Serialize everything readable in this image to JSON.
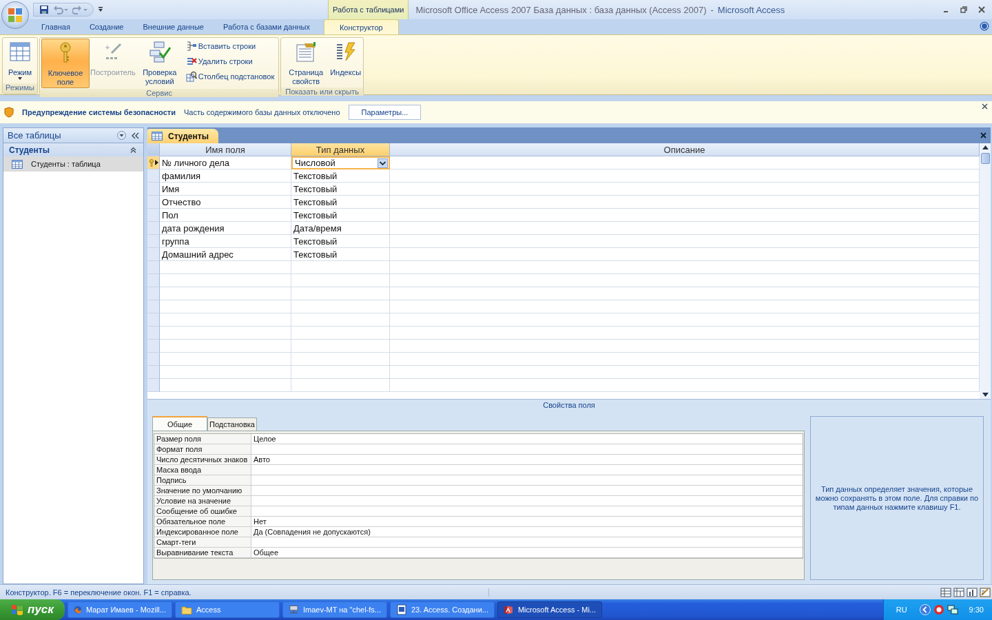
{
  "window": {
    "context": "Работа с таблицами",
    "title": "Microsoft Office Access 2007 База данных : база данных (Access 2007)",
    "separator": "-",
    "app": "Microsoft Access"
  },
  "ribbon_tabs": [
    {
      "label": "Главная",
      "selected": false
    },
    {
      "label": "Создание",
      "selected": false
    },
    {
      "label": "Внешние данные",
      "selected": false
    },
    {
      "label": "Работа с базами данных",
      "selected": false
    },
    {
      "label": "Конструктор",
      "selected": true
    }
  ],
  "ribbon_groups": [
    {
      "label": "Режимы",
      "buttons": [
        {
          "label": "Режим",
          "kind": "view",
          "selected": false,
          "disabled": false
        }
      ]
    },
    {
      "label": "Сервис",
      "buttons": [
        {
          "label": "Ключевое поле",
          "kind": "key",
          "selected": true,
          "disabled": false
        },
        {
          "label": "Построитель",
          "kind": "builder",
          "selected": false,
          "disabled": true
        },
        {
          "label": "Проверка условий",
          "kind": "check",
          "selected": false,
          "disabled": false
        },
        {
          "label": "Вставить строки",
          "kind": "insert",
          "selected": false,
          "disabled": false
        },
        {
          "label": "Удалить строки",
          "kind": "delete",
          "selected": false,
          "disabled": false
        },
        {
          "label": "Столбец  подстановок",
          "kind": "lookup",
          "selected": false,
          "disabled": false
        }
      ]
    },
    {
      "label": "Показать или скрыть",
      "buttons": [
        {
          "label": "Страница свойств",
          "kind": "sheet",
          "selected": false,
          "disabled": false
        },
        {
          "label": "Индексы",
          "kind": "indexes",
          "selected": false,
          "disabled": false
        }
      ]
    }
  ],
  "security_bar": {
    "title": "Предупреждение системы безопасности",
    "message": "Часть содержимого базы данных отключено",
    "button": "Параметры..."
  },
  "nav_pane": {
    "header": "Все таблицы",
    "group": "Студенты",
    "items": [
      {
        "label": "Студенты : таблица",
        "selected": true
      }
    ]
  },
  "document_tab": {
    "label": "Студенты"
  },
  "design_grid": {
    "columns": [
      "Имя поля",
      "Тип данных",
      "Описание"
    ],
    "rows": [
      {
        "name": "№ личного дела",
        "type": "Числовой",
        "primary_key": true,
        "selected": true
      },
      {
        "name": "фамилия",
        "type": "Текстовый",
        "primary_key": false,
        "selected": false
      },
      {
        "name": "Имя",
        "type": "Текстовый",
        "primary_key": false,
        "selected": false
      },
      {
        "name": "Отчество",
        "type": "Текстовый",
        "primary_key": false,
        "selected": false
      },
      {
        "name": "Пол",
        "type": "Текстовый",
        "primary_key": false,
        "selected": false
      },
      {
        "name": "дата рождения",
        "type": "Дата/время",
        "primary_key": false,
        "selected": false
      },
      {
        "name": "группа",
        "type": "Текстовый",
        "primary_key": false,
        "selected": false
      },
      {
        "name": "Домашний адрес",
        "type": "Текстовый",
        "primary_key": false,
        "selected": false
      }
    ]
  },
  "field_properties": {
    "title": "Свойства поля",
    "tabs": [
      {
        "label": "Общие",
        "selected": true
      },
      {
        "label": "Подстановка",
        "selected": false
      }
    ],
    "rows": [
      {
        "label": "Размер поля",
        "value": "Целое"
      },
      {
        "label": "Формат поля"
      },
      {
        "label": "Число десятичных знаков",
        "value": "Авто"
      },
      {
        "label": "Маска ввода"
      },
      {
        "label": "Подпись"
      },
      {
        "label": "Значение по умолчанию"
      },
      {
        "label": "Условие на значение"
      },
      {
        "label": "Сообщение об ошибке"
      },
      {
        "label": "Обязательное поле",
        "value": "Нет"
      },
      {
        "label": "Индексированное поле",
        "value": "Да (Совпадения не допускаются)"
      },
      {
        "label": "Смарт-теги"
      },
      {
        "label": "Выравнивание текста",
        "value": "Общее"
      }
    ],
    "help": "Тип данных определяет значения, которые можно сохранять в этом поле.  Для справки по типам данных нажмите клавишу F1."
  },
  "status_bar": {
    "text": "Конструктор.  F6 = переключение окон.  F1 = справка."
  },
  "taskbar": {
    "start": "пуск",
    "tasks": [
      {
        "label": "Марат Имаев - Mozill...",
        "kind": "browser",
        "selected": false
      },
      {
        "label": "Access",
        "kind": "folder",
        "selected": false
      },
      {
        "label": "Imaev-MT на \"chel-fs...",
        "kind": "network",
        "selected": false
      },
      {
        "label": "23. Access. Создани...",
        "kind": "document",
        "selected": false
      },
      {
        "label": "Microsoft Access - Mi...",
        "kind": "access",
        "selected": true
      }
    ],
    "language": "RU",
    "time": "9:30"
  }
}
